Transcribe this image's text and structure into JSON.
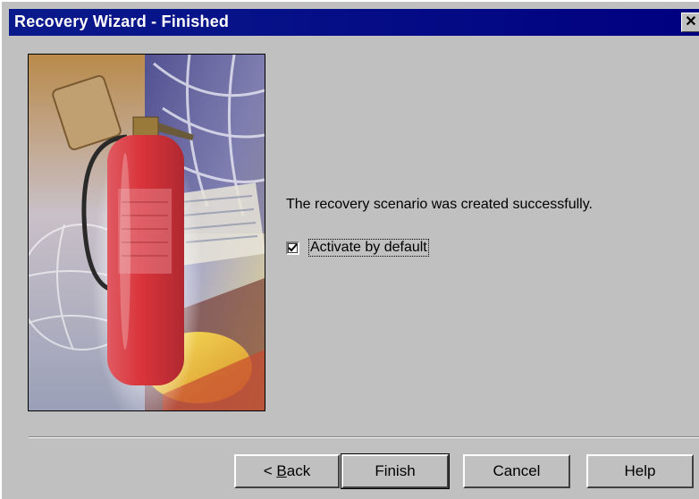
{
  "window": {
    "title": "Recovery Wizard - Finished",
    "close_glyph": "✕"
  },
  "content": {
    "message": "The recovery scenario was created successfully.",
    "activate_checkbox": {
      "label": "Activate by default",
      "checked": true
    }
  },
  "buttons": {
    "back_arrow": "<",
    "back_mnemonic": "B",
    "back_rest": "ack",
    "finish": "Finish",
    "cancel": "Cancel",
    "help": "Help"
  },
  "colors": {
    "titlebar": "#000080",
    "dialog_bg": "#c0c0c0",
    "extinguisher_red": "#d9343a"
  },
  "icons": {
    "illustration": "fire-extinguisher-collage",
    "close": "close-icon",
    "check": "checkmark-icon"
  }
}
